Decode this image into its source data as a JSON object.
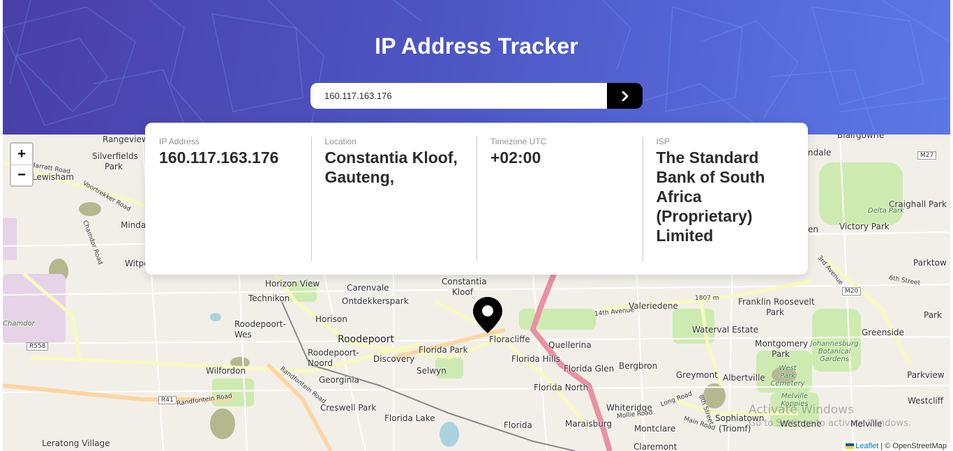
{
  "header": {
    "title": "IP Address Tracker",
    "search_value": "160.117.163.176"
  },
  "card": {
    "items": [
      {
        "label": "IP Address",
        "value": "160.117.163.176"
      },
      {
        "label": "Location",
        "value": "Constantia Kloof, Gauteng,"
      },
      {
        "label": "Timezone UTC",
        "value": "+02:00"
      },
      {
        "label": "ISP",
        "value": "The Standard Bank of South Africa (Proprietary) Limited"
      }
    ]
  },
  "map": {
    "zoom_in": "+",
    "zoom_out": "−",
    "attribution_link": "Leaflet",
    "attribution_text": " | © OpenStreetMap",
    "labels": {
      "rangeview": "Rangeview",
      "silverfields": "Silverfields",
      "park": "Park",
      "lewisham": "Lewisham",
      "minda": "Minda",
      "witpo": "Witpo",
      "chamdor": "Chamdor",
      "horizon_view": "Horizon View",
      "technikon": "Technikon",
      "carenvale": "Carenvale",
      "ontdekkerspark": "Ontdekkerspark",
      "constantia_kloof": "Constantia Kloof",
      "horison": "Horison",
      "roodepoort_wes": "Roodepoort-Wes",
      "roodepoort": "Roodepoort",
      "roodepoort_noord": "Roodepoort-Noord",
      "wilfordon": "Wilfordon",
      "georginia": "Georginia",
      "discovery": "Discovery",
      "selwyn": "Selwyn",
      "florida_park": "Florida Park",
      "floracliffe": "Floracliffe",
      "florida_hills": "Florida Hills",
      "quellerina": "Quellerina",
      "florida_glen": "Florida Glen",
      "bergbron": "Bergbron",
      "florida_north": "Florida North",
      "creswell_park": "Creswell Park",
      "florida_lake": "Florida Lake",
      "florida": "Florida",
      "whiteridge": "Whiteridge",
      "maraisburg": "Maraisburg",
      "montclare": "Montclare",
      "claremont": "Claremont",
      "leratong": "Leratong Village",
      "valeriedene": "Valeriedene",
      "franklin": "Franklin Roosevelt",
      "franklin_park": "Park",
      "waterval": "Waterval Estate",
      "montgomery": "Montgomery",
      "montgomery_park": "Park",
      "greymont": "Greymont",
      "albertville": "Albertville",
      "sophiatown": "Sophiatown",
      "triomf": "(Triomf)",
      "westdene": "Westdene",
      "melville": "Melville",
      "greenside": "Greenside",
      "parkview": "Parkview",
      "westcliff": "Westcliff",
      "victory_park": "Victory Park",
      "craighall": "Craighall Park",
      "parktown": "Parktow",
      "blairgowrie": "Blairgowrie",
      "ndale": "ndale",
      "en": "en",
      "park_r": "Park",
      "elevation": "1807 m",
      "jhb_botanical": "Johannesburg Botanical Gardens",
      "west_park": "West Park Cemetery",
      "melville_koppies": "Melville Koppies",
      "delta_park": "Delta Park",
      "r558": "R558",
      "r41": "R41",
      "m27": "M27",
      "m20": "M20",
      "randfontein_road": "Randfontein Road",
      "randfontein_road2": "Randfontein Road",
      "barratt_road": "Barratt Road",
      "voortrekker_road": "Voortrekker Road",
      "chamdor_road": "Chamdor Road",
      "fourteenth_avenue": "14th Avenue",
      "long_road": "Long Road",
      "mollie_road": "Mollie Road",
      "main_road": "Main Road",
      "eighth_street": "8th Street",
      "third_avenue": "3rd Avenue",
      "sixth_street": "6th Street"
    },
    "watermark_line1": "Activate Windows",
    "watermark_line2": "Go to Settings to activate Windows."
  },
  "colors": {
    "header_start": "#4a3fa8",
    "header_end": "#5b78e6",
    "search_button": "#000000",
    "map_background": "#f2efe9"
  },
  "icons": {
    "search_button_icon": "chevron-right-icon",
    "marker_icon": "location-pin-icon"
  }
}
